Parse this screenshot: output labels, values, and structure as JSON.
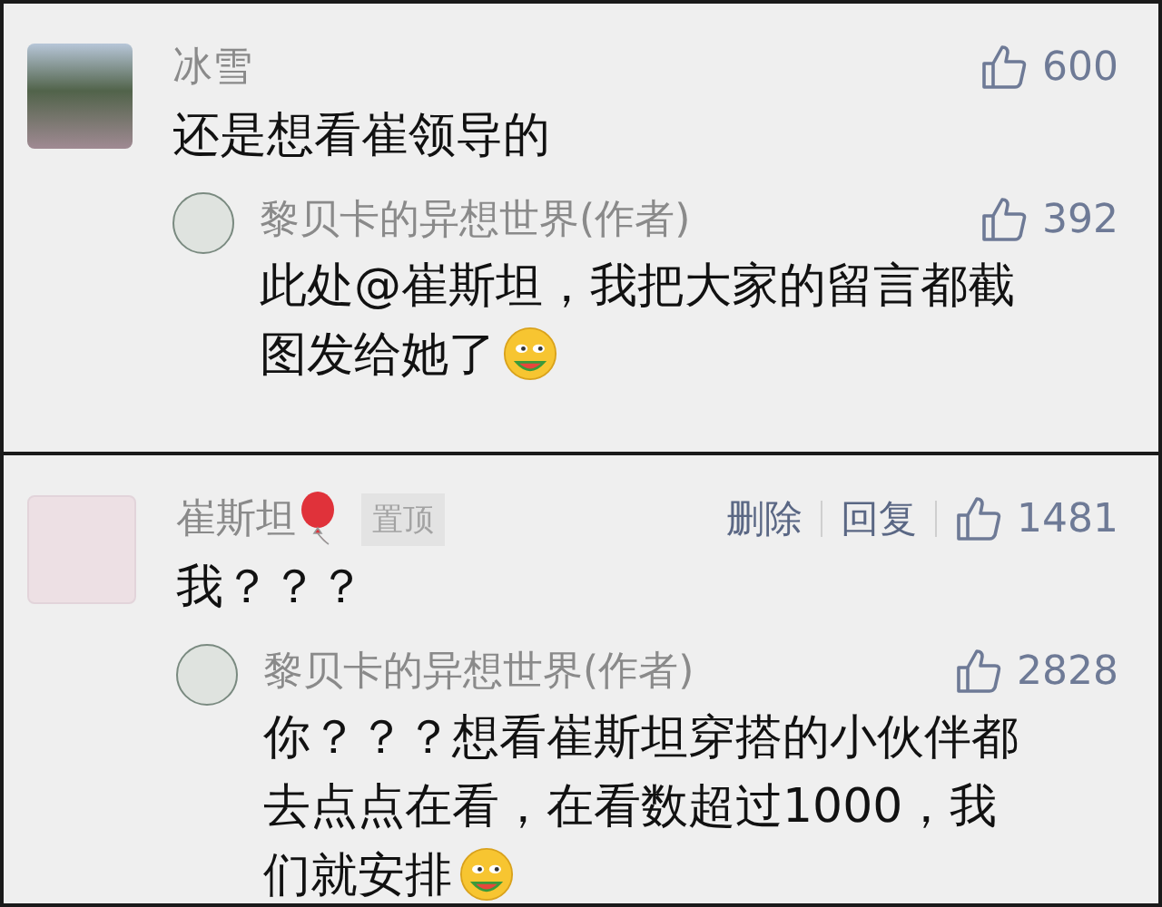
{
  "threads": [
    {
      "comment": {
        "name": "冰雪",
        "likes": "600",
        "text": "还是想看崔领导的"
      },
      "reply": {
        "name": "黎贝卡的异想世界(作者)",
        "likes": "392",
        "lines": [
          "此处@崔斯坦，我把大家的留言都截",
          "图发给她了"
        ],
        "emoji": true
      }
    },
    {
      "comment": {
        "name": "崔斯坦",
        "balloon": true,
        "pinned_label": "置顶",
        "actions": [
          "删除",
          "回复"
        ],
        "likes": "1481",
        "text": "我？？？"
      },
      "reply": {
        "name": "黎贝卡的异想世界(作者)",
        "likes": "2828",
        "lines": [
          "你？？？想看崔斯坦穿搭的小伙伴都",
          "去点点在看，在看数超过1000，我",
          "们就安排"
        ],
        "emoji": true
      }
    }
  ]
}
